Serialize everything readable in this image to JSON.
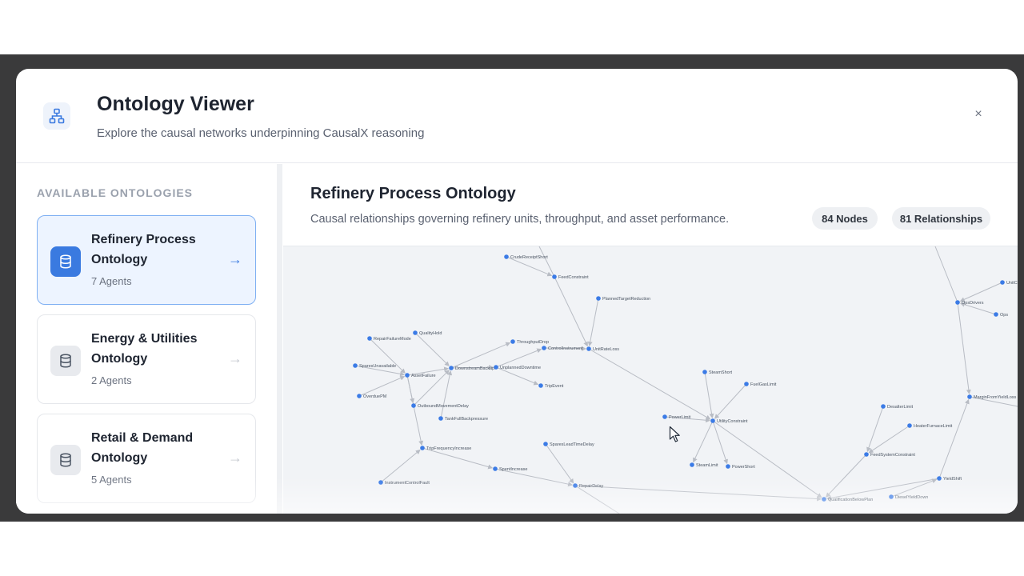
{
  "header": {
    "title": "Ontology Viewer",
    "subtitle": "Explore the causal networks underpinning CausalX reasoning",
    "icon": "network-icon",
    "close_icon": "close-icon",
    "close_label": "×"
  },
  "sidebar": {
    "section_label": "AVAILABLE ONTOLOGIES",
    "items": [
      {
        "title": "Refinery Process Ontology",
        "agents": "7 Agents",
        "icon": "database-icon",
        "active": true,
        "arrow": "→"
      },
      {
        "title": "Energy & Utilities Ontology",
        "agents": "2 Agents",
        "icon": "database-icon",
        "active": false,
        "arrow": "→"
      },
      {
        "title": "Retail & Demand Ontology",
        "agents": "5 Agents",
        "icon": "database-icon",
        "active": false,
        "arrow": "→"
      }
    ]
  },
  "main": {
    "title": "Refinery Process Ontology",
    "description": "Causal relationships governing refinery units, throughput, and asset performance.",
    "nodes_badge": "84 Nodes",
    "relationships_badge": "81 Relationships"
  },
  "graph": {
    "node_color": "#3b7be6",
    "edge_color": "#b8bcc4",
    "nodes": [
      {
        "id": "CrudeReceiptShort",
        "label": "CrudeReceiptShort"
      },
      {
        "id": "FeedConstraint",
        "label": "FeedConstraint"
      },
      {
        "id": "PlannedTargetReduction",
        "label": "PlannedTargetReduction"
      },
      {
        "id": "UnitRateLoss",
        "label": "UnitRateLoss"
      },
      {
        "id": "RepairFailureMode",
        "label": "RepairFailureMode"
      },
      {
        "id": "QualityHold",
        "label": "QualityHold"
      },
      {
        "id": "ThroughputDrop",
        "label": "ThroughputDrop"
      },
      {
        "id": "ControlInstrument",
        "label": "ControlInstrument"
      },
      {
        "id": "SparesUnavailable",
        "label": "SparesUnavailable"
      },
      {
        "id": "AssetFailure",
        "label": "AssetFailure"
      },
      {
        "id": "DownstreamBackup",
        "label": "DownstreamBackup"
      },
      {
        "id": "UnplannedDowntime",
        "label": "UnplannedDowntime"
      },
      {
        "id": "TripEvent",
        "label": "TripEvent"
      },
      {
        "id": "OverduePM",
        "label": "OverduePM"
      },
      {
        "id": "OutboundMovementDelay",
        "label": "OutboundMovementDelay"
      },
      {
        "id": "TankFullBackpressure",
        "label": "TankFullBackpressure"
      },
      {
        "id": "TripFrequencyIncrease",
        "label": "TripFrequencyIncrease"
      },
      {
        "id": "SparesLeadTimeDelay",
        "label": "SparesLeadTimeDelay"
      },
      {
        "id": "SpentIncrease",
        "label": "SpentIncrease"
      },
      {
        "id": "InstrumentControlFault",
        "label": "InstrumentControlFault"
      },
      {
        "id": "RepairDelay",
        "label": "RepairDelay"
      },
      {
        "id": "SteamShort",
        "label": "SteamShort"
      },
      {
        "id": "FuelGasLimit",
        "label": "FuelGasLimit"
      },
      {
        "id": "PowerLimit",
        "label": "PowerLimit"
      },
      {
        "id": "UtilityConstraint",
        "label": "UtilityConstraint"
      },
      {
        "id": "SteamLimit",
        "label": "SteamLimit"
      },
      {
        "id": "PowerShort",
        "label": "PowerShort"
      },
      {
        "id": "OpsDrivers",
        "label": "OpsDrivers"
      },
      {
        "id": "MarginFromYieldLoss",
        "label": "MarginFromYieldLoss"
      },
      {
        "id": "DesalterLimit",
        "label": "DesalterLimit"
      },
      {
        "id": "HeaterFurnaceLimit",
        "label": "HeaterFurnaceLimit"
      },
      {
        "id": "FeedSystemConstraint",
        "label": "FeedSystemConstraint"
      },
      {
        "id": "YieldShift",
        "label": "YieldShift"
      },
      {
        "id": "DieselYieldDown",
        "label": "DieselYieldDown"
      },
      {
        "id": "QualificationBelowPlan",
        "label": "QualificationBelowPlan"
      },
      {
        "id": "UnitC",
        "label": "UnitC"
      },
      {
        "id": "Ops",
        "label": "Ops"
      }
    ]
  }
}
